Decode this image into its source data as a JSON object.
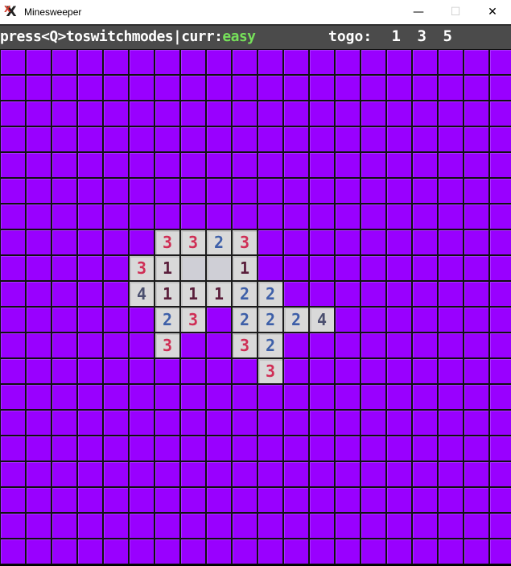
{
  "window": {
    "title": "Minesweeper",
    "icon": "minesweeper-x-icon",
    "controls": {
      "minimize": "—",
      "maximize": "☐",
      "close": "✕"
    }
  },
  "status": {
    "instruction": "press<Q>toswitchmodes|curr:",
    "mode": "easy",
    "togo_label": "togo:",
    "togo_digits": [
      "1",
      "3",
      "5"
    ]
  },
  "colors": {
    "hidden_cell": "#9900ff",
    "revealed_cell": "#d9d9d9",
    "number_1": "#5a1e3a",
    "number_2": "#3d5fa8",
    "number_3": "#cf2e55",
    "number_4": "#4a4f6e",
    "mode_text": "#76e05a",
    "status_bar": "#4b4b4b"
  },
  "board": {
    "rows": 20,
    "cols": 20,
    "cells": [
      "####################",
      "####################",
      "####################",
      "####################",
      "####################",
      "####################",
      "####################",
      "######3323##########",
      "#####31  1##########",
      "#####411122#########",
      "######23#2224#######",
      "######3##32#########",
      "##########3#########",
      "####################",
      "####################",
      "####################",
      "####################",
      "####################",
      "####################",
      "####################"
    ]
  }
}
